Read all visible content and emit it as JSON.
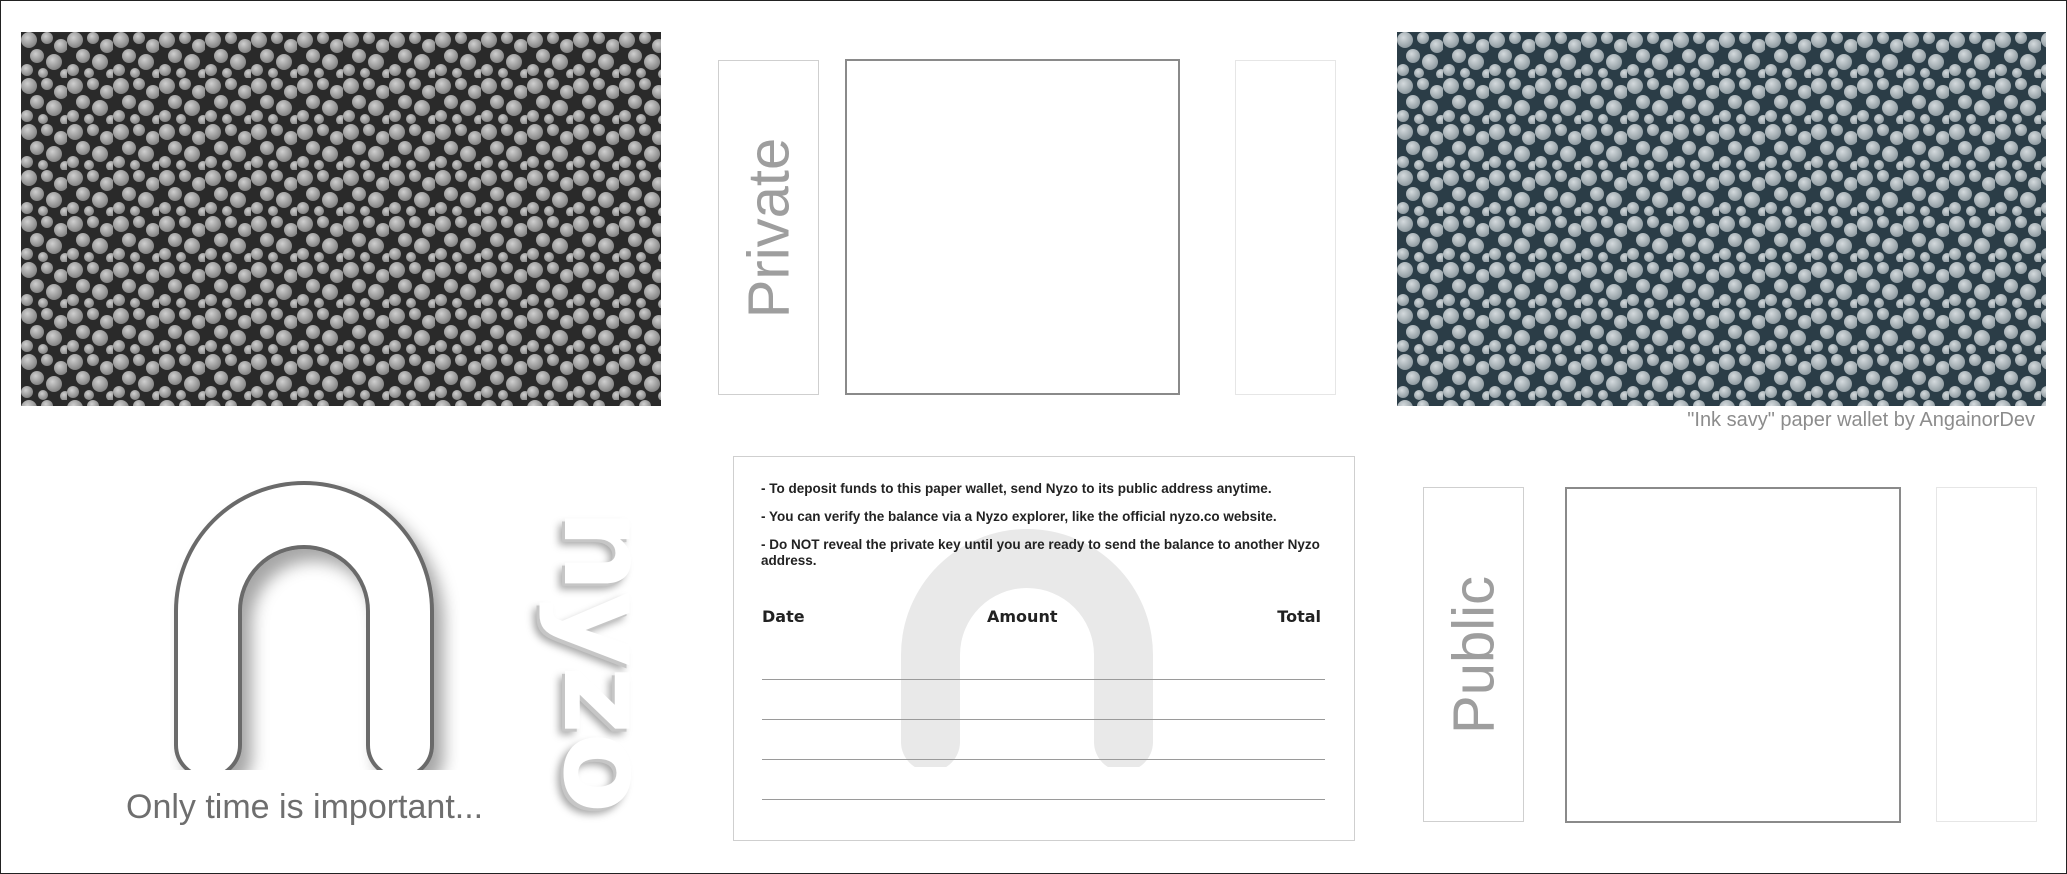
{
  "private_section": {
    "label": "Private"
  },
  "public_section": {
    "label": "Public"
  },
  "credit": "\"Ink savy\" paper wallet by AngainorDev",
  "motto": "Only time is important...",
  "brand_wordmark": "nyzo",
  "notes": [
    "- To deposit funds to this paper wallet, send Nyzo to its public address anytime.",
    "- You can verify the balance via a Nyzo explorer, like the official nyzo.co website.",
    "- Do NOT reveal the private key until you are ready to send the balance to another Nyzo address."
  ],
  "ledger": {
    "columns": [
      "Date",
      "Amount",
      "Total"
    ],
    "rows": [
      "",
      "",
      "",
      ""
    ]
  },
  "colors": {
    "pattern_private": "#2a2a2a",
    "pattern_public": "#2b3d47",
    "pattern_spots": "#a8a8a8"
  }
}
